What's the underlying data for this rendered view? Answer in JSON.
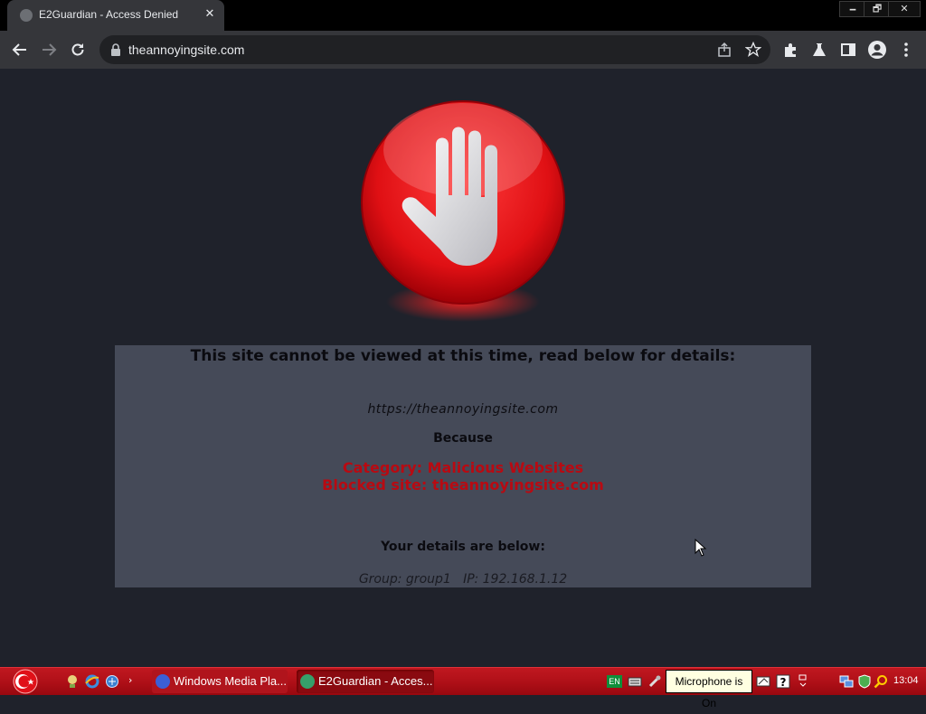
{
  "browser": {
    "tab_title": "E2Guardian - Access Denied",
    "tab_close": "✕",
    "url": "theannoyingsite.com",
    "window_controls": {
      "minimize": "🗕",
      "restore": "🗗",
      "close": "✕"
    }
  },
  "page": {
    "heading": "This site cannot be viewed at this time, read below for details:",
    "url_line": "https://theannoyingsite.com",
    "because": "Because",
    "category": "Category: Malicious Websites",
    "blocked": "Blocked site: theannoyingsite.com",
    "details_label": "Your details are below:",
    "user_line": "Group: group1   IP: 192.168.1.12"
  },
  "taskbar": {
    "windows": [
      {
        "label": "Windows Media Pla..."
      },
      {
        "label": "E2Guardian - Acces..."
      }
    ],
    "language": "EN",
    "tooltip": "Microphone is On",
    "clock": "13:04"
  },
  "colors": {
    "page_bg": "#1f222b",
    "panel_bg": "#454a58",
    "alert_red": "#b80a12",
    "taskbar_red": "#b01018"
  },
  "icons": {
    "stop": "stop-hand-icon",
    "lock": "lock-icon",
    "star": "star-icon",
    "share": "share-icon",
    "extensions": "puzzle-icon",
    "labs": "flask-icon",
    "sidepanel": "sidepanel-icon",
    "profile": "profile-icon",
    "menu": "kebab-menu-icon"
  }
}
